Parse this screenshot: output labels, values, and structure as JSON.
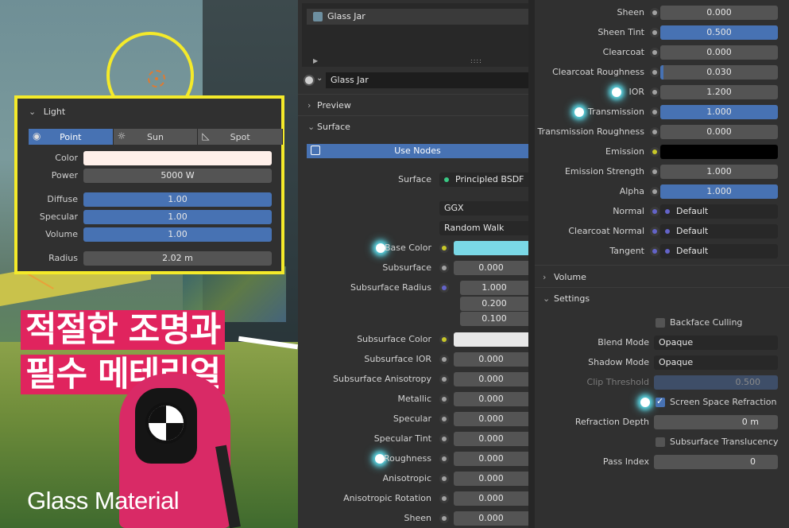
{
  "light_panel": {
    "title": "Light",
    "tabs": [
      "Point",
      "Sun",
      "Spot"
    ],
    "rows": [
      {
        "label": "Color",
        "value": ""
      },
      {
        "label": "Power",
        "value": "5000 W"
      },
      {
        "label": "Diffuse",
        "value": "1.00"
      },
      {
        "label": "Specular",
        "value": "1.00"
      },
      {
        "label": "Volume",
        "value": "1.00"
      },
      {
        "label": "Radius",
        "value": "2.02 m"
      }
    ],
    "color_swatch": "#fff0ea"
  },
  "overlay": {
    "kr_line1": "적절한 조명과",
    "kr_line2": "필수 메테리얼",
    "en_title": "Glass Material"
  },
  "material": {
    "slot_name": "Glass Jar",
    "datablock_name": "Glass Jar",
    "slot_footer_dots": "::::"
  },
  "sections": {
    "preview": "Preview",
    "surface": "Surface",
    "use_nodes": "Use Nodes",
    "volume": "Volume",
    "settings": "Settings"
  },
  "surface_props": [
    {
      "label": "Surface",
      "value": "Principled BSDF"
    },
    {
      "label": "",
      "value": "GGX"
    },
    {
      "label": "",
      "value": "Random Walk"
    },
    {
      "label": "Base Color",
      "value": ""
    },
    {
      "label": "Subsurface",
      "value": "0.000"
    },
    {
      "label": "Subsurface Radius",
      "value": "1.000"
    },
    {
      "label": "",
      "value": "0.200"
    },
    {
      "label": "",
      "value": "0.100"
    },
    {
      "label": "Subsurface Color",
      "value": ""
    },
    {
      "label": "Subsurface IOR",
      "value": "0.000"
    },
    {
      "label": "Subsurface Anisotropy",
      "value": "0.000"
    },
    {
      "label": "Metallic",
      "value": "0.000"
    },
    {
      "label": "Specular",
      "value": "0.000"
    },
    {
      "label": "Specular Tint",
      "value": "0.000"
    },
    {
      "label": "Roughness",
      "value": "0.000"
    },
    {
      "label": "Anisotropic",
      "value": "0.000"
    },
    {
      "label": "Anisotropic Rotation",
      "value": "0.000"
    },
    {
      "label": "Sheen",
      "value": "0.000"
    }
  ],
  "right_props": [
    {
      "label": "Sheen",
      "value": "0.000",
      "fill": 0
    },
    {
      "label": "Sheen Tint",
      "value": "0.500",
      "fill": 1
    },
    {
      "label": "Clearcoat",
      "value": "0.000",
      "fill": 0
    },
    {
      "label": "Clearcoat Roughness",
      "value": "0.030",
      "fill": 0.03
    },
    {
      "label": "IOR",
      "value": "1.200",
      "fill": 0
    },
    {
      "label": "Transmission",
      "value": "1.000",
      "fill": 1
    },
    {
      "label": "Transmission Roughness",
      "value": "0.000",
      "fill": 0
    },
    {
      "label": "Emission",
      "value": "",
      "fill": 0
    },
    {
      "label": "Emission Strength",
      "value": "1.000",
      "fill": 0
    },
    {
      "label": "Alpha",
      "value": "1.000",
      "fill": 1
    },
    {
      "label": "Normal",
      "value": "Default"
    },
    {
      "label": "Clearcoat Normal",
      "value": "Default"
    },
    {
      "label": "Tangent",
      "value": "Default"
    }
  ],
  "settings": {
    "backface_culling": "Backface Culling",
    "blend_mode_label": "Blend Mode",
    "blend_mode_value": "Opaque",
    "shadow_mode_label": "Shadow Mode",
    "shadow_mode_value": "Opaque",
    "clip_threshold_label": "Clip Threshold",
    "clip_threshold_value": "0.500",
    "ssr_label": "Screen Space Refraction",
    "refraction_depth_label": "Refraction Depth",
    "refraction_depth_value": "0 m",
    "subsurface_translucency": "Subsurface Translucency",
    "pass_index_label": "Pass Index",
    "pass_index_value": "0"
  },
  "colors": {
    "accent_blue": "#4772b3",
    "highlight_yellow": "#f4ea2a",
    "base_color": "#7ad8e6",
    "subsurface_color": "#e8e8e8",
    "glow": "#5ad8e6",
    "socket_yellow": "#c7c729",
    "socket_purple": "#6363c7",
    "socket_green": "#39c884",
    "title_pink": "#e0245e"
  }
}
